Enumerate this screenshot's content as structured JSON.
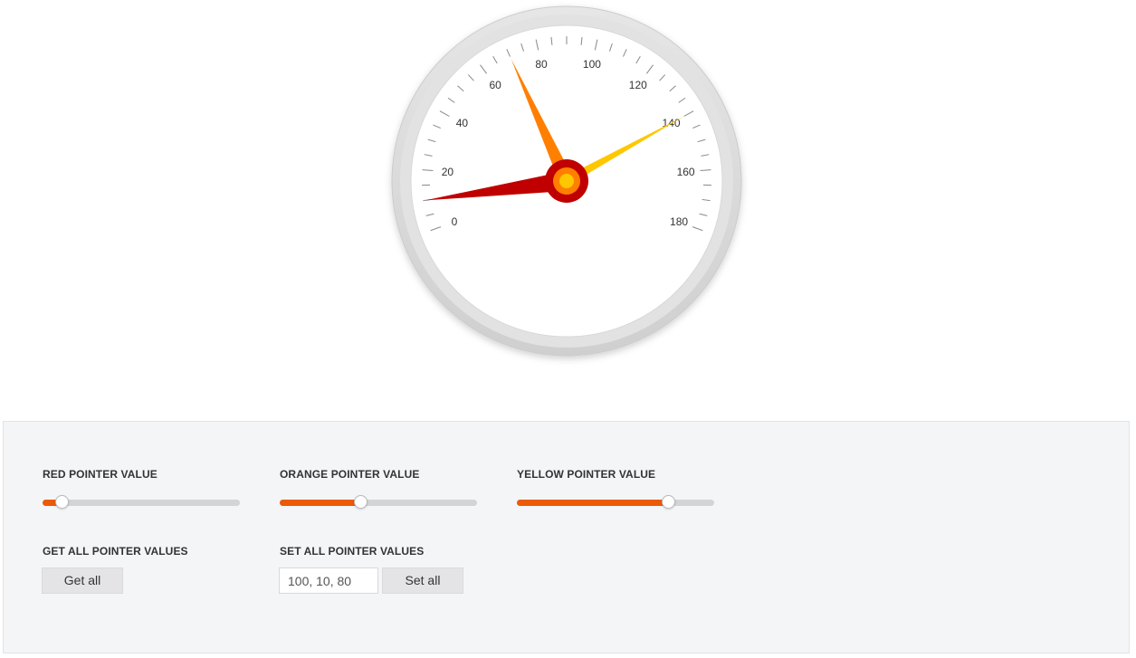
{
  "gauge": {
    "scale": {
      "min": 0,
      "max": 180,
      "major_unit": 20,
      "minor_unit": 5
    },
    "tick_labels": [
      "0",
      "20",
      "40",
      "60",
      "80",
      "100",
      "120",
      "140",
      "160",
      "180"
    ],
    "pointers": [
      {
        "name": "red",
        "value": 10,
        "color": "#c00000"
      },
      {
        "name": "orange",
        "value": 70,
        "color": "#ff7f00"
      },
      {
        "name": "yellow",
        "value": 140,
        "color": "#ffc700"
      }
    ],
    "colors": {
      "rim": "#d6d6d6",
      "face": "#ffffff",
      "tick": "#888888",
      "label": "#333333"
    }
  },
  "controls": {
    "red": {
      "label": "RED POINTER VALUE",
      "value": 10
    },
    "orange": {
      "label": "ORANGE POINTER VALUE",
      "value": 70
    },
    "yellow": {
      "label": "YELLOW POINTER VALUE",
      "value": 140
    },
    "slider_range": {
      "min": 0,
      "max": 180
    },
    "accent_color": "#ec5a06",
    "get_all": {
      "label": "GET ALL POINTER VALUES",
      "button": "Get all"
    },
    "set_all": {
      "label": "SET ALL POINTER VALUES",
      "input_value": "100, 10, 80",
      "button": "Set all"
    }
  }
}
